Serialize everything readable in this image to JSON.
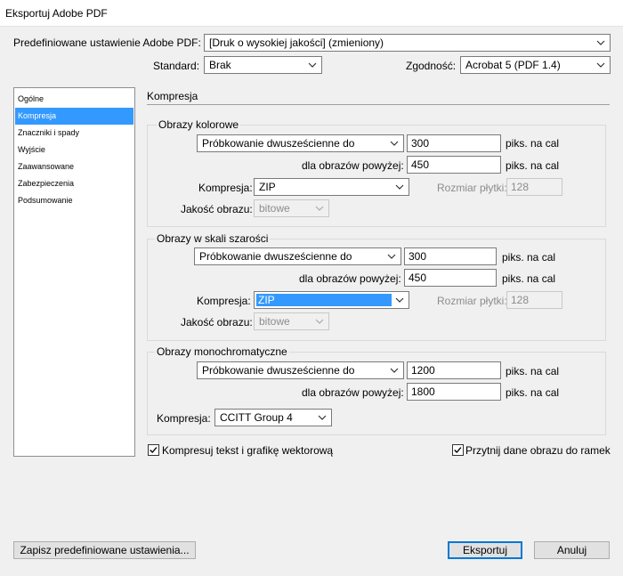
{
  "window": {
    "title": "Eksportuj Adobe PDF"
  },
  "preset": {
    "label": "Predefiniowane ustawienie Adobe PDF:",
    "value": "[Druk o wysokiej jakości] (zmieniony)"
  },
  "standard": {
    "label": "Standard:",
    "value": "Brak"
  },
  "compat": {
    "label": "Zgodność:",
    "value": "Acrobat 5 (PDF 1.4)"
  },
  "sidebar": {
    "items": [
      {
        "label": "Ogólne"
      },
      {
        "label": "Kompresja",
        "selected": true
      },
      {
        "label": "Znaczniki i spady"
      },
      {
        "label": "Wyjście"
      },
      {
        "label": "Zaawansowane"
      },
      {
        "label": "Zabezpieczenia"
      },
      {
        "label": "Podsumowanie"
      }
    ]
  },
  "section_title": "Kompresja",
  "color_images": {
    "title": "Obrazy kolorowe",
    "sampling": "Próbkowanie dwusześcienne do",
    "resolution": "300",
    "unit": "piks. na cal",
    "above_label": "dla obrazów powyżej:",
    "above_value": "450",
    "above_unit": "piks. na cal",
    "compression_label": "Kompresja:",
    "compression": "ZIP",
    "tile_label": "Rozmiar płytki:",
    "tile_value": "128",
    "quality_label": "Jakość obrazu:",
    "quality": "bitowe"
  },
  "gray_images": {
    "title": "Obrazy w skali szarości",
    "sampling": "Próbkowanie dwusześcienne do",
    "resolution": "300",
    "unit": "piks. na cal",
    "above_label": "dla obrazów powyżej:",
    "above_value": "450",
    "above_unit": "piks. na cal",
    "compression_label": "Kompresja:",
    "compression": "ZIP",
    "tile_label": "Rozmiar płytki:",
    "tile_value": "128",
    "quality_label": "Jakość obrazu:",
    "quality": "bitowe"
  },
  "mono_images": {
    "title": "Obrazy monochromatyczne",
    "sampling": "Próbkowanie dwusześcienne do",
    "resolution": "1200",
    "unit": "piks. na cal",
    "above_label": "dla obrazów powyżej:",
    "above_value": "1800",
    "above_unit": "piks. na cal",
    "compression_label": "Kompresja:",
    "compression": "CCITT Group 4"
  },
  "options": {
    "compress_text": {
      "label": "Kompresuj tekst i grafikę wektorową",
      "checked": true
    },
    "crop_image": {
      "label": "Przytnij dane obrazu do ramek",
      "checked": true
    }
  },
  "buttons": {
    "save_preset": "Zapisz predefiniowane ustawienia...",
    "export": "Eksportuj",
    "cancel": "Anuluj"
  },
  "colors": {
    "accent": "#3399ff",
    "background": "#f0f0f0"
  }
}
